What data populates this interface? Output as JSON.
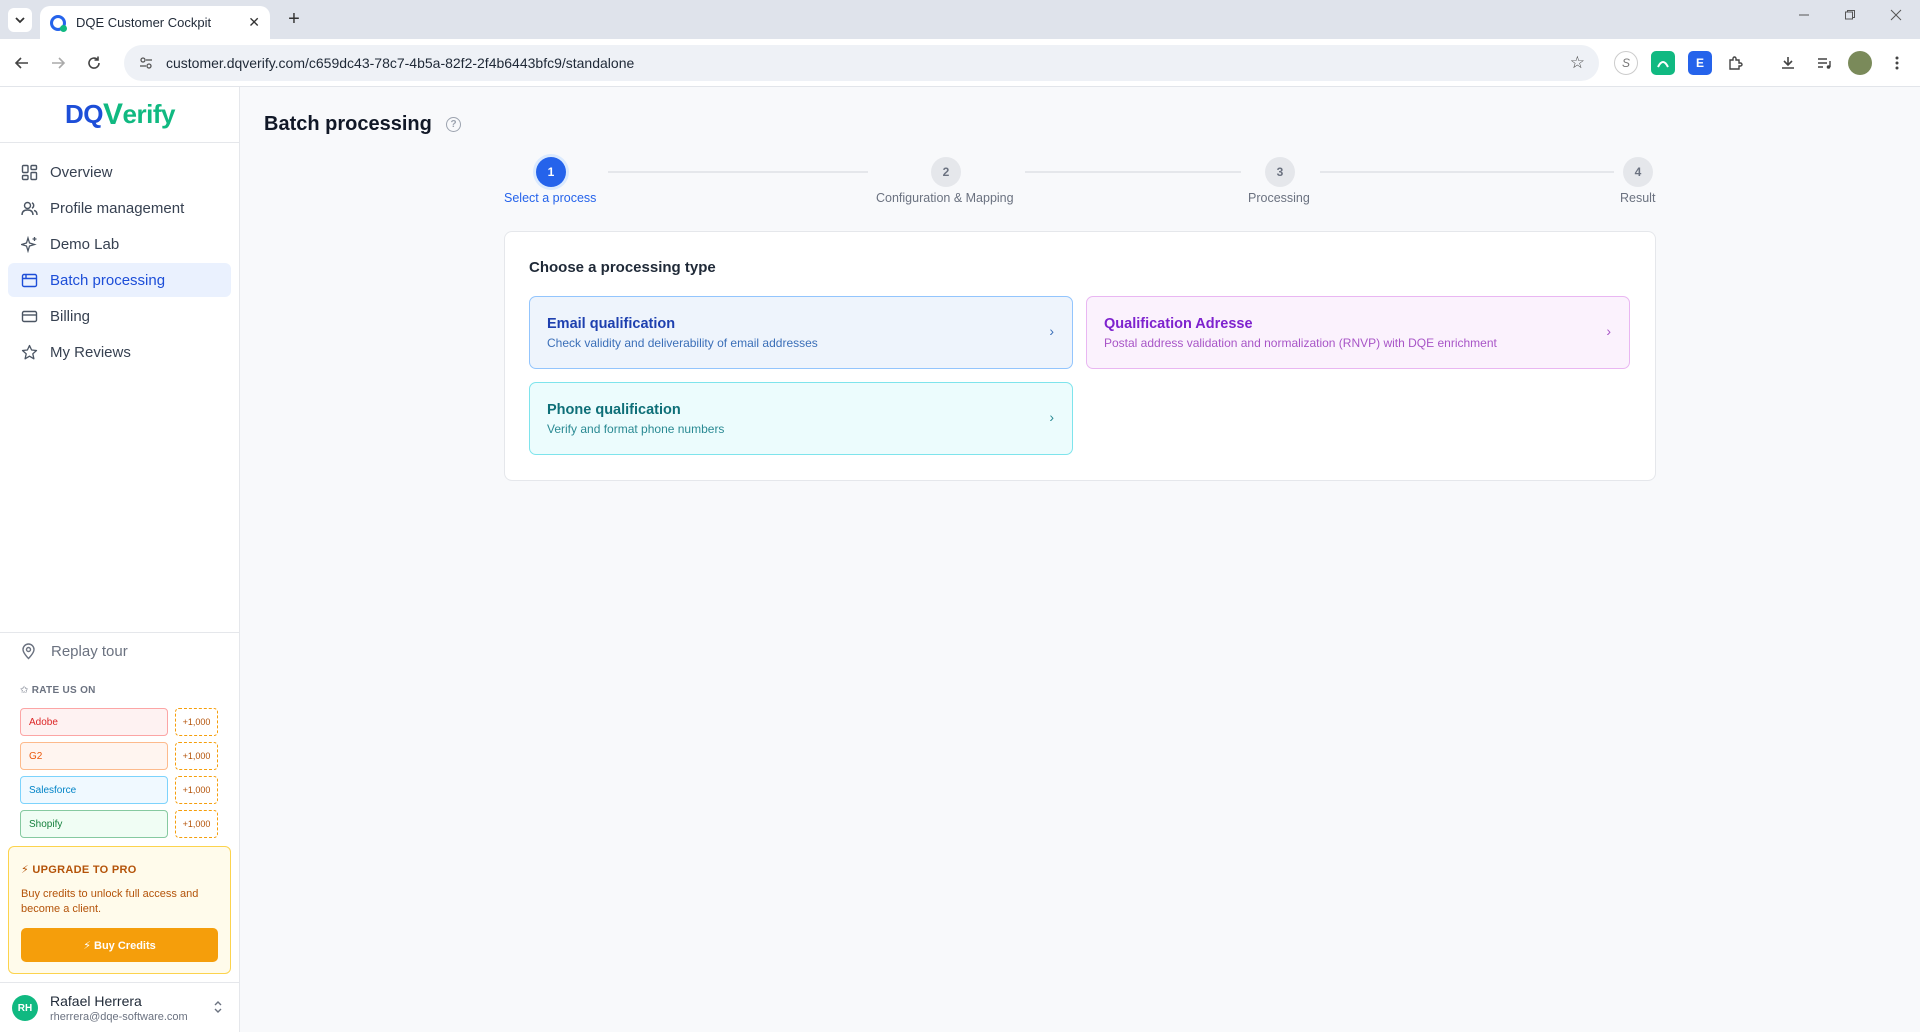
{
  "browser": {
    "tab_title": "DQE Customer Cockpit",
    "tab_close": "✕",
    "new_tab": "+",
    "url": "customer.dqverify.com/c659dc43-78c7-4b5a-82f2-2f4b6443bfc9/standalone",
    "ext_s": "S",
    "ext_e": "E"
  },
  "logo": {
    "dq": "DQ",
    "v": "V",
    "rest": "erify"
  },
  "sidebar": {
    "items": [
      {
        "label": "Overview",
        "icon": "grid-icon"
      },
      {
        "label": "Profile management",
        "icon": "users-icon"
      },
      {
        "label": "Demo Lab",
        "icon": "sparkle-icon"
      },
      {
        "label": "Batch processing",
        "icon": "batch-icon",
        "active": true
      },
      {
        "label": "Billing",
        "icon": "card-icon"
      },
      {
        "label": "My Reviews",
        "icon": "star-icon"
      }
    ],
    "replay": "Replay tour",
    "rate_heading": "✩ RATE US ON",
    "rate": [
      {
        "label": "Adobe",
        "points": "+1,000",
        "color": "#dc2626"
      },
      {
        "label": "G2",
        "points": "+1,000",
        "color": "#ea580c"
      },
      {
        "label": "Salesforce",
        "points": "+1,000",
        "color": "#0284c7"
      },
      {
        "label": "Shopify",
        "points": "+1,000",
        "color": "#15803d"
      }
    ],
    "upgrade": {
      "title": "⚡ UPGRADE TO PRO",
      "desc": "Buy credits to unlock full access and become a client.",
      "button": "⚡ Buy Credits"
    },
    "user": {
      "initials": "RH",
      "name": "Rafael Herrera",
      "email": "rherrera@dqe-software.com"
    }
  },
  "main": {
    "title": "Batch processing",
    "help": "?",
    "steps": [
      {
        "num": "1",
        "label": "Select a process",
        "active": true
      },
      {
        "num": "2",
        "label": "Configuration & Mapping"
      },
      {
        "num": "3",
        "label": "Processing"
      },
      {
        "num": "4",
        "label": "Result"
      }
    ],
    "card_title": "Choose a processing type",
    "options": [
      {
        "title": "Email qualification",
        "desc": "Check validity and deliverability of email addresses"
      },
      {
        "title": "Qualification Adresse",
        "desc": "Postal address validation and normalization (RNVP) with DQE enrichment"
      },
      {
        "title": "Phone qualification",
        "desc": "Verify and format phone numbers"
      }
    ],
    "chevron": "›"
  },
  "colors": {
    "primary": "#2563eb",
    "brand_green": "#10b981",
    "amber": "#f59e0b"
  }
}
